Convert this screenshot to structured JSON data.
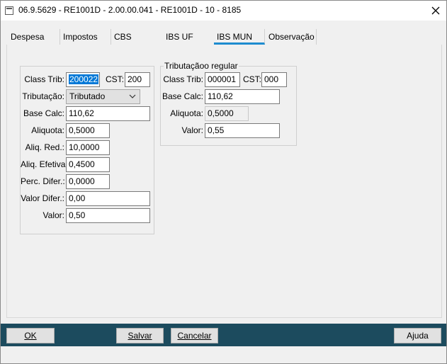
{
  "window": {
    "title": "06.9.5629 - RE1001D - 2.00.00.041 - RE1001D - 10 - 8185"
  },
  "tabs": [
    {
      "label": "Despesa"
    },
    {
      "label": "Impostos"
    },
    {
      "label": "CBS"
    },
    {
      "label": "IBS UF"
    },
    {
      "label": "IBS MUN"
    },
    {
      "label": "Observação"
    }
  ],
  "active_tab": "IBS MUN",
  "left_group": {
    "class_trib_label": "Class Trib:",
    "class_trib_value": "200022",
    "cst_label": "CST:",
    "cst_value": "200",
    "tributacao_label": "Tributação:",
    "tributacao_value": "Tributado",
    "base_calc_label": "Base Calc:",
    "base_calc_value": "110,62",
    "aliquota_label": "Aliquota:",
    "aliquota_value": "0,5000",
    "aliq_red_label": "Aliq. Red.:",
    "aliq_red_value": "10,0000",
    "aliq_efetiva_label": "Aliq. Efetiva:",
    "aliq_efetiva_value": "0,4500",
    "perc_difer_label": "Perc. Difer.:",
    "perc_difer_value": "0,0000",
    "valor_difer_label": "Valor Difer.:",
    "valor_difer_value": "0,00",
    "valor_label": "Valor:",
    "valor_value": "0,50"
  },
  "right_group": {
    "title": "Tributaçãoo regular",
    "class_trib_label": "Class Trib:",
    "class_trib_value": "000001",
    "cst_label": "CST:",
    "cst_value": "000",
    "base_calc_label": "Base Calc:",
    "base_calc_value": "110,62",
    "aliquota_label": "Aliquota:",
    "aliquota_value": "0,5000",
    "valor_label": "Valor:",
    "valor_value": "0,55"
  },
  "footer": {
    "ok_label": "OK",
    "save_label": "Salvar",
    "cancel_label": "Cancelar",
    "help_label": "Ajuda"
  },
  "colors": {
    "footer_bg": "#1c4b5e",
    "active_tab_underline": "#1e8ccf",
    "selection": "#0078d7"
  }
}
